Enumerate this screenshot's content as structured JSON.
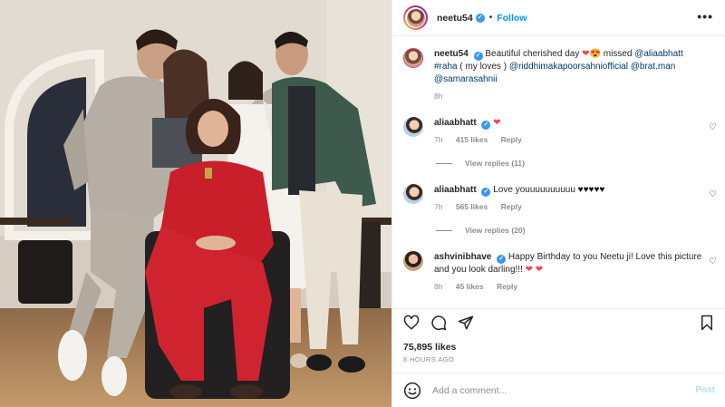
{
  "post": {
    "username": "neetu54",
    "follow_label": "Follow",
    "dot": "•",
    "caption": {
      "username": "neetu54",
      "text_1": "Beautiful cherished day",
      "text_2": "missed",
      "mention_1": "@aliaabhatt",
      "hashtag": "#raha",
      "text_3": "( my loves )",
      "mention_2": "@riddhimakapoorsahniofficial",
      "mention_3": "@brat.man",
      "mention_4": "@samarasahnii",
      "time": "8h"
    },
    "comments": [
      {
        "username": "aliaabhatt",
        "text": "",
        "emoji": "❤",
        "time": "7h",
        "likes": "415 likes",
        "reply": "Reply",
        "view_replies": "View replies (11)"
      },
      {
        "username": "aliaabhatt",
        "text": "Love youuuuuuuuuu",
        "emoji": "♥♥♥♥♥",
        "time": "7h",
        "likes": "565 likes",
        "reply": "Reply",
        "view_replies": "View replies (20)"
      },
      {
        "username": "ashvinibhave",
        "text": "Happy Birthday to you Neetu ji! Love this picture and you look darling!!!",
        "emoji": "❤ ❤",
        "time": "8h",
        "likes": "45 likes",
        "reply": "Reply",
        "view_replies": ""
      }
    ],
    "likes_count": "75,895 likes",
    "time_ago": "8 HOURS AGO",
    "add_comment_placeholder": "Add a comment...",
    "post_label": "Post",
    "more_label": "•••",
    "verified_mark": "✓",
    "small_heart": "♡"
  },
  "colors": {
    "accent": "#0095f6",
    "verified": "#3897f0",
    "heart": "#ed4956",
    "muted": "#8e8e8e",
    "mention": "#00376b"
  },
  "icons": {
    "like": "heart-outline-icon",
    "comment": "comment-bubble-icon",
    "share": "paper-plane-icon",
    "save": "bookmark-icon",
    "emoji": "smiley-icon",
    "more": "more-horizontal-icon",
    "verified": "verified-badge-icon"
  }
}
